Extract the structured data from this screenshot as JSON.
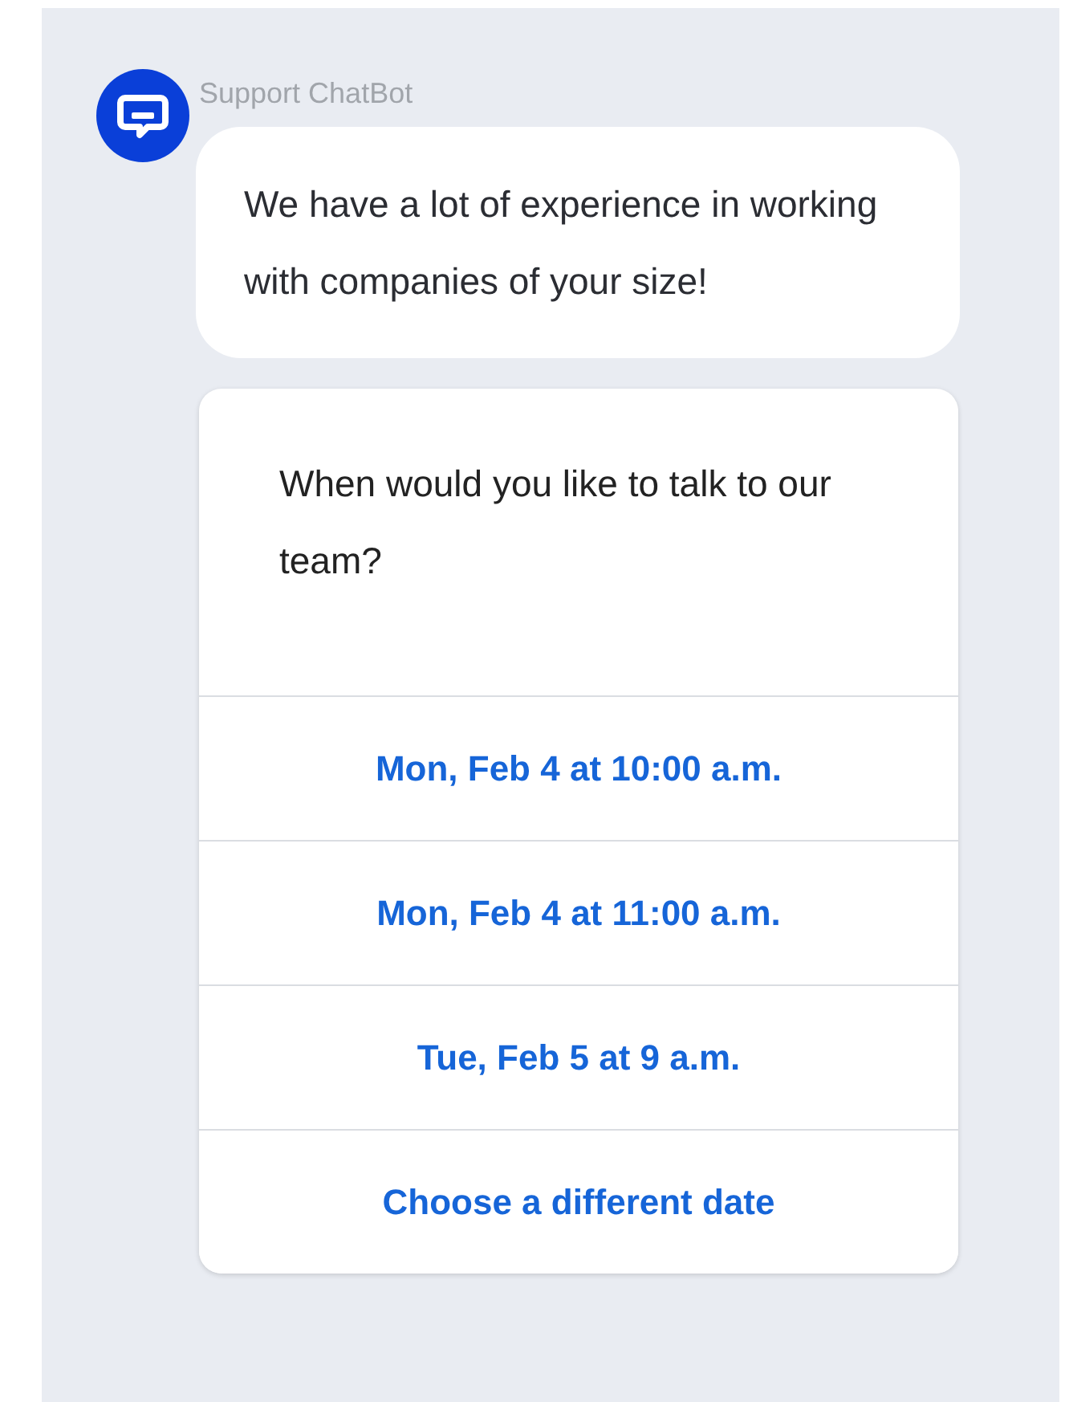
{
  "bot": {
    "name": "Support ChatBot"
  },
  "messages": [
    {
      "kind": "text",
      "text": "We have a lot of experience in working with companies of your size!"
    },
    {
      "kind": "choices",
      "text": "When would you like to talk to our team?",
      "options": [
        "Mon, Feb 4 at 10:00 a.m.",
        "Mon, Feb 4 at 11:00 a.m.",
        "Tue, Feb 5 at 9 a.m.",
        "Choose a different date"
      ]
    }
  ]
}
